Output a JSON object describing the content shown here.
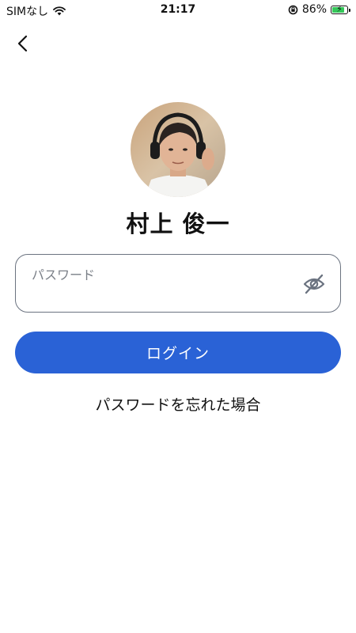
{
  "status_bar": {
    "carrier": "SIMなし",
    "time": "21:17",
    "battery_percent": "86%",
    "battery_level": 0.86,
    "icons": [
      "wifi-icon",
      "orientation-lock-icon",
      "battery-charging-icon"
    ]
  },
  "nav": {
    "back_icon": "chevron-left-icon"
  },
  "profile": {
    "name": "村上 俊一"
  },
  "password": {
    "label": "パスワード",
    "value": "",
    "toggle_icon": "eye-slash-icon"
  },
  "actions": {
    "login_label": "ログイン",
    "forgot_label": "パスワードを忘れた場合"
  },
  "colors": {
    "primary": "#2a62d6",
    "field_border": "#6b7380",
    "label_gray": "#7a7f87",
    "battery_green": "#34c759"
  }
}
